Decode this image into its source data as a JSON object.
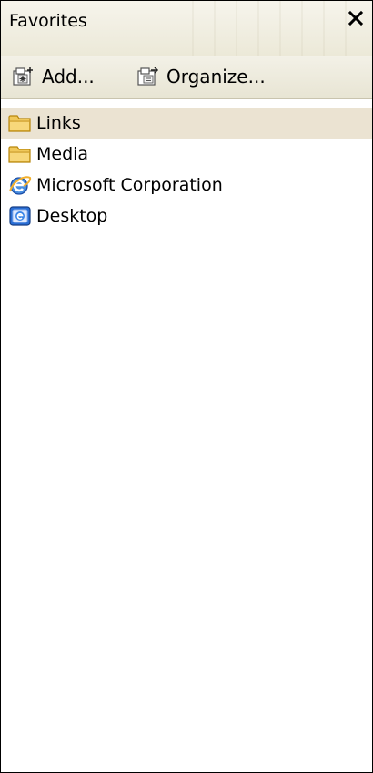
{
  "panel": {
    "title": "Favorites",
    "close_icon": "close-icon"
  },
  "toolbar": {
    "add_label": "Add...",
    "add_icon": "add-favorite-icon",
    "organize_label": "Organize...",
    "organize_icon": "organize-favorites-icon"
  },
  "favorites": [
    {
      "label": "Links",
      "icon": "folder-icon",
      "selected": true
    },
    {
      "label": "Media",
      "icon": "folder-icon",
      "selected": false
    },
    {
      "label": "Microsoft Corporation",
      "icon": "internet-explorer-icon",
      "selected": false
    },
    {
      "label": "Desktop",
      "icon": "desktop-shortcut-icon",
      "selected": false
    }
  ],
  "colors": {
    "selected_row": "#ebe3d2",
    "header_bg": "#ece9d8",
    "folder_yellow": "#f0c85a",
    "ie_blue": "#2a6fd6"
  }
}
